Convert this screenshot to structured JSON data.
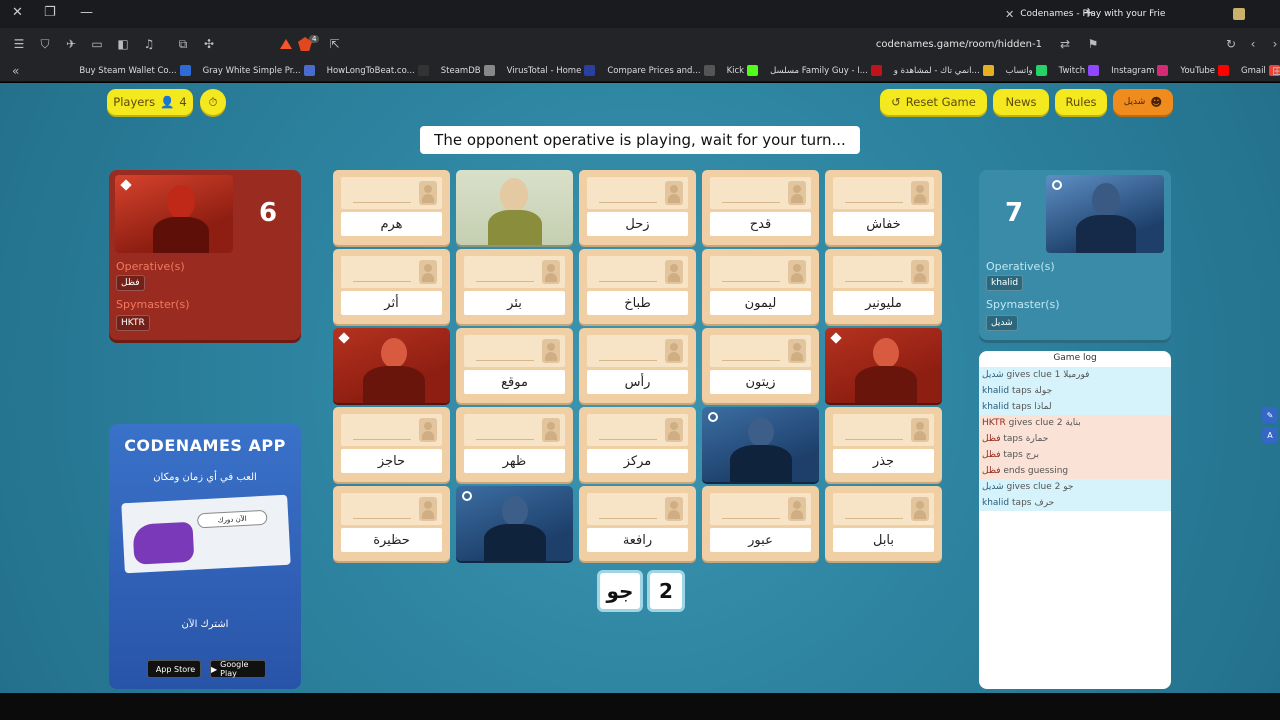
{
  "browser": {
    "tab_title": "Codenames - Play with your Frie",
    "url": "codenames.game/room/hidden-1",
    "shield_badge": "4",
    "bookmarks": [
      {
        "label": "Buy Steam Wallet Co...",
        "color": "#2f6bd6"
      },
      {
        "label": "Gray White Simple Pr...",
        "color": "#4a6ccf"
      },
      {
        "label": "HowLongToBeat.co...",
        "color": "#333"
      },
      {
        "label": "SteamDB",
        "color": "#888"
      },
      {
        "label": "VirusTotal - Home",
        "color": "#2a3fa0"
      },
      {
        "label": "Compare Prices and...",
        "color": "#555"
      },
      {
        "label": "Kick",
        "color": "#53fc18"
      },
      {
        "label": "مسلسل Family Guy - ا...",
        "color": "#c0141b"
      },
      {
        "label": "انمي تاك - لمشاهدة و...",
        "color": "#e6b020"
      },
      {
        "label": "واتساب",
        "color": "#25d366"
      },
      {
        "label": "Twitch",
        "color": "#9146ff"
      },
      {
        "label": "Instagram",
        "color": "#d62976"
      },
      {
        "label": "YouTube",
        "color": "#ff0000"
      },
      {
        "label": "Gmail",
        "color": "#ea4335"
      }
    ]
  },
  "toolbar": {
    "players_label": "Players",
    "players_count": "4",
    "reset_label": "Reset Game",
    "news_label": "News",
    "rules_label": "Rules",
    "user_label": "شديل"
  },
  "status": "The opponent operative is playing, wait for your turn...",
  "red_team": {
    "score": "6",
    "operatives_label": "Operative(s)",
    "operatives": [
      "فظل"
    ],
    "spymasters_label": "Spymaster(s)",
    "spymasters": [
      "HKTR"
    ]
  },
  "blue_team": {
    "score": "7",
    "operatives_label": "Operative(s)",
    "operatives": [
      "khalid"
    ],
    "spymasters_label": "Spymaster(s)",
    "spymasters": [
      "شديل"
    ]
  },
  "board": [
    {
      "word": "هرم",
      "state": "word"
    },
    {
      "word": "",
      "state": "bystander"
    },
    {
      "word": "زحل",
      "state": "word"
    },
    {
      "word": "قدح",
      "state": "word"
    },
    {
      "word": "خفاش",
      "state": "word"
    },
    {
      "word": "أثر",
      "state": "word"
    },
    {
      "word": "بئر",
      "state": "word"
    },
    {
      "word": "طباخ",
      "state": "word"
    },
    {
      "word": "ليمون",
      "state": "word"
    },
    {
      "word": "مليونير",
      "state": "word"
    },
    {
      "word": "",
      "state": "red"
    },
    {
      "word": "موقع",
      "state": "word"
    },
    {
      "word": "رأس",
      "state": "word"
    },
    {
      "word": "زيتون",
      "state": "word"
    },
    {
      "word": "",
      "state": "red"
    },
    {
      "word": "حاجز",
      "state": "word"
    },
    {
      "word": "ظهر",
      "state": "word"
    },
    {
      "word": "مركز",
      "state": "word"
    },
    {
      "word": "",
      "state": "blue"
    },
    {
      "word": "جذر",
      "state": "word"
    },
    {
      "word": "حظيرة",
      "state": "word"
    },
    {
      "word": "",
      "state": "blue"
    },
    {
      "word": "رافعة",
      "state": "word"
    },
    {
      "word": "عبور",
      "state": "word"
    },
    {
      "word": "بابل",
      "state": "word"
    }
  ],
  "clue": {
    "word": "جو",
    "number": "2"
  },
  "game_log": {
    "title": "Game log",
    "entries": [
      {
        "team": "blue",
        "who": "شديل",
        "action": "gives clue",
        "detail": "فورميلا 1"
      },
      {
        "team": "blue",
        "who": "khalid",
        "action": "taps",
        "detail": "جولة"
      },
      {
        "team": "blue",
        "who": "khalid",
        "action": "taps",
        "detail": "لماذا"
      },
      {
        "team": "red",
        "who": "HKTR",
        "action": "gives clue",
        "detail": "بناية 2"
      },
      {
        "team": "red",
        "who": "فظل",
        "action": "taps",
        "detail": "حمارة"
      },
      {
        "team": "red",
        "who": "فظل",
        "action": "taps",
        "detail": "برج"
      },
      {
        "team": "red",
        "who": "فظل",
        "action": "ends guessing",
        "detail": ""
      },
      {
        "team": "blue",
        "who": "شديل",
        "action": "gives clue",
        "detail": "جو 2"
      },
      {
        "team": "blue",
        "who": "khalid",
        "action": "taps",
        "detail": "حرف"
      }
    ]
  },
  "promo": {
    "title": "CODENAMES APP",
    "subtitle": "العب في أي زمان ومكان",
    "bubble": "الآن دورك",
    "cta": "اشترك الآن",
    "app_store": "App Store",
    "google_play": "Google Play"
  }
}
